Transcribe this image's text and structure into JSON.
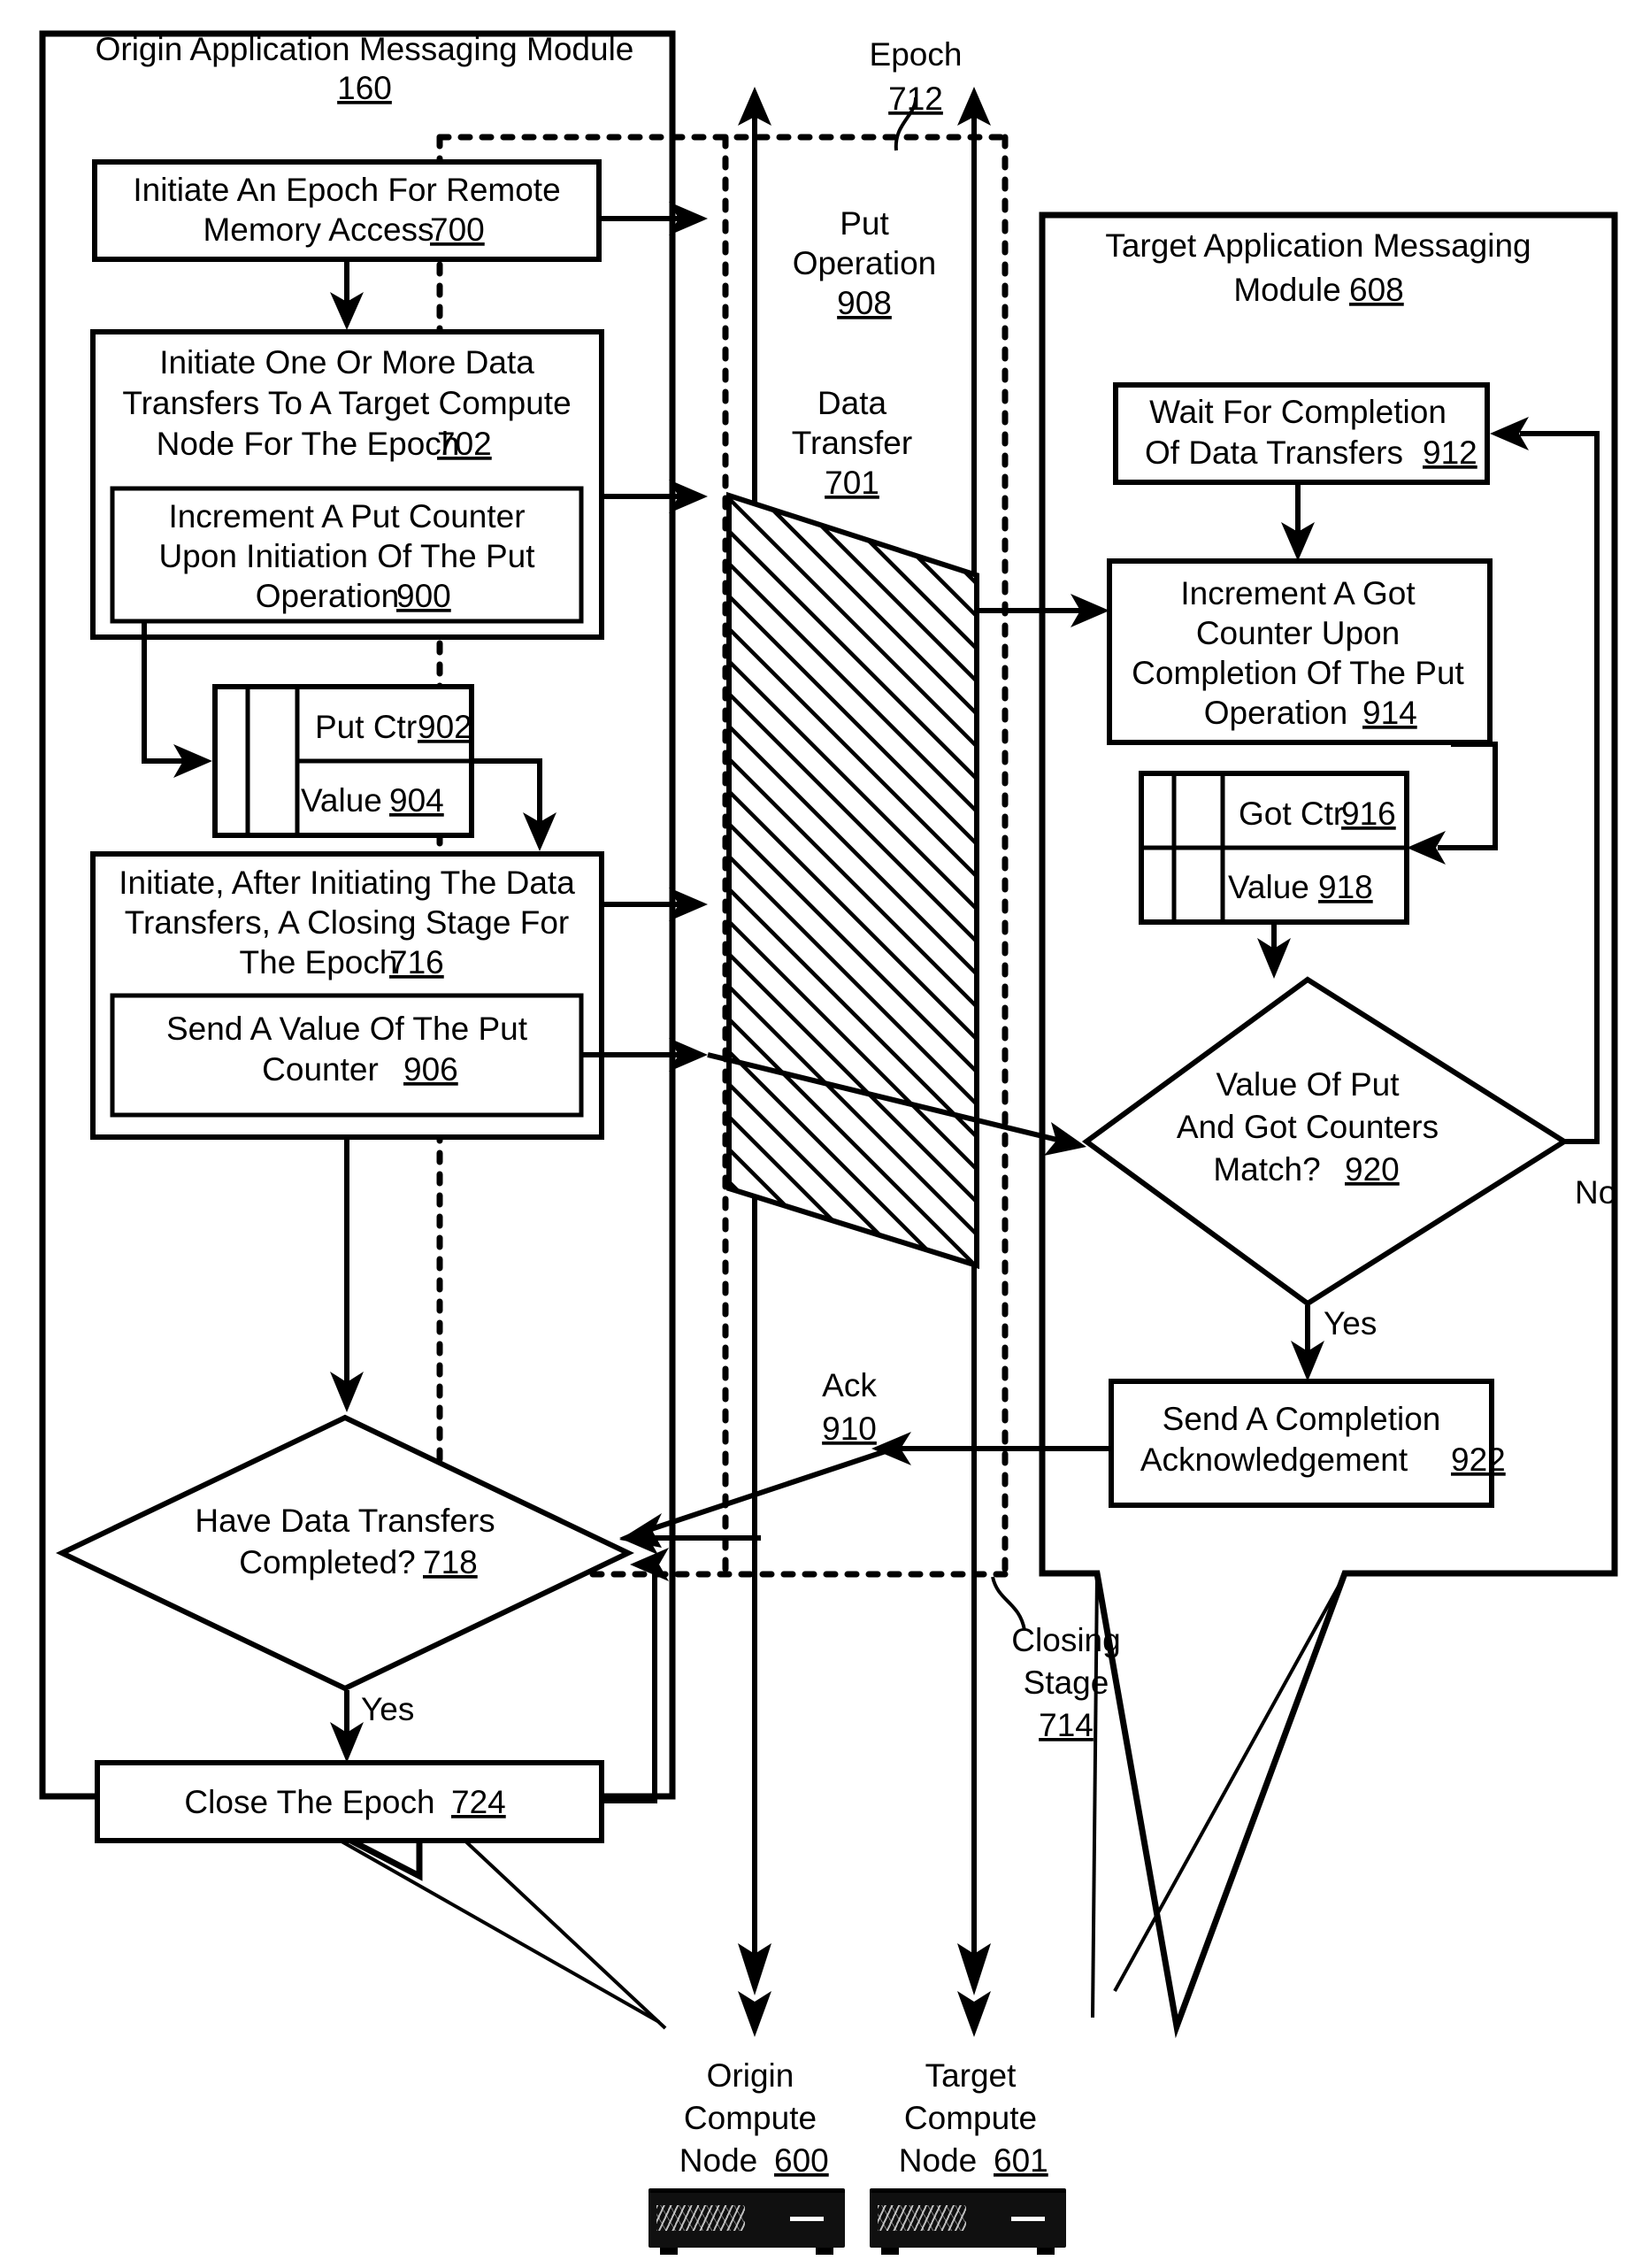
{
  "figure": {
    "origin_panel": {
      "title_line1": "Origin Application Messaging Module",
      "title_ref": "160",
      "steps": {
        "s700": {
          "line1": "Initiate An Epoch For Remote",
          "line2": "Memory Access",
          "ref": "700"
        },
        "s702": {
          "line1": "Initiate One Or More Data",
          "line2": "Transfers To A Target Compute",
          "line3": "Node For The Epoch",
          "ref": "702"
        },
        "s900": {
          "line1": "Increment A Put Counter",
          "line2": "Upon Initiation Of The Put",
          "line3": "Operation",
          "ref": "900"
        },
        "s902": {
          "label": "Put Ctr",
          "ref": "902"
        },
        "s904": {
          "label": "Value",
          "ref": "904"
        },
        "s716": {
          "line1": "Initiate, After Initiating The Data",
          "line2": "Transfers, A Closing Stage For",
          "line3": "The Epoch",
          "ref": "716"
        },
        "s906": {
          "line1": "Send A Value Of The Put",
          "line2": "Counter",
          "ref": "906"
        },
        "s718": {
          "line1": "Have Data Transfers",
          "line2": "Completed?",
          "ref": "718",
          "branch_yes": "Yes"
        },
        "s724": {
          "line1": "Close The Epoch",
          "ref": "724"
        }
      }
    },
    "target_panel": {
      "title_line1": "Target Application Messaging",
      "title_line2": "Module",
      "title_ref": "608",
      "steps": {
        "s912": {
          "line1": "Wait For Completion",
          "line2": "Of Data Transfers",
          "ref": "912"
        },
        "s914": {
          "line1": "Increment A Got",
          "line2": "Counter Upon",
          "line3": "Completion Of The Put",
          "line4": "Operation",
          "ref": "914"
        },
        "s916": {
          "label": "Got Ctr",
          "ref": "916"
        },
        "s918": {
          "label": "Value",
          "ref": "918"
        },
        "s920": {
          "line1": "Value Of Put",
          "line2": "And Got Counters",
          "line3": "Match?",
          "ref": "920",
          "branch_yes": "Yes",
          "branch_no": "No"
        },
        "s922": {
          "line1": "Send A Completion",
          "line2": "Acknowledgement",
          "ref": "922"
        }
      }
    },
    "middle": {
      "epoch": {
        "label": "Epoch",
        "ref": "712"
      },
      "put_operation": {
        "line1": "Put",
        "line2": "Operation",
        "ref": "908"
      },
      "data_transfer": {
        "line1": "Data",
        "line2": "Transfer",
        "ref": "701"
      },
      "ack": {
        "label": "Ack",
        "ref": "910"
      },
      "closing_stage": {
        "line1": "Closing",
        "line2": "Stage",
        "ref": "714"
      }
    },
    "bottom": {
      "origin_node": {
        "line1": "Origin",
        "line2": "Compute",
        "line3": "Node",
        "ref": "600"
      },
      "target_node": {
        "line1": "Target",
        "line2": "Compute",
        "line3": "Node",
        "ref": "601"
      }
    },
    "colors": {
      "ink": "#000000",
      "paper": "#ffffff"
    }
  }
}
